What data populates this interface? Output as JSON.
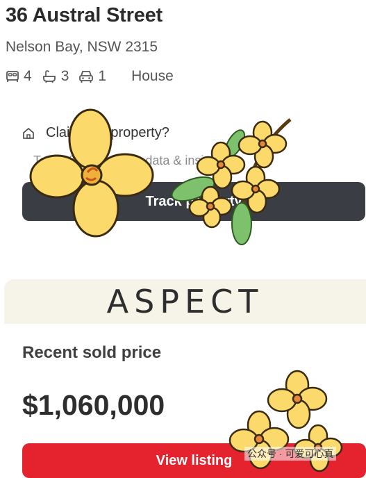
{
  "listing": {
    "address": "36 Austral Street",
    "suburb": "Nelson Bay, NSW 2315",
    "features": {
      "beds": "4",
      "baths": "3",
      "cars": "1",
      "type": "House"
    }
  },
  "claim": {
    "title": "Claim this property?",
    "subtitle": "Track & view owner data & insights.",
    "button_label": "Track property"
  },
  "agency": {
    "logo_text": "ASPECT"
  },
  "sold": {
    "label": "Recent sold price",
    "price": "$1,060,000",
    "button_label": "View listing"
  },
  "overlay": {
    "watermark": "公众号 · 可爱可心真"
  },
  "colors": {
    "dark_button": "#3b3d44",
    "accent_red": "#e4232f",
    "band": "#f6f3e8",
    "flower_yellow": "#fbd96a",
    "flower_center": "#e8873a"
  }
}
